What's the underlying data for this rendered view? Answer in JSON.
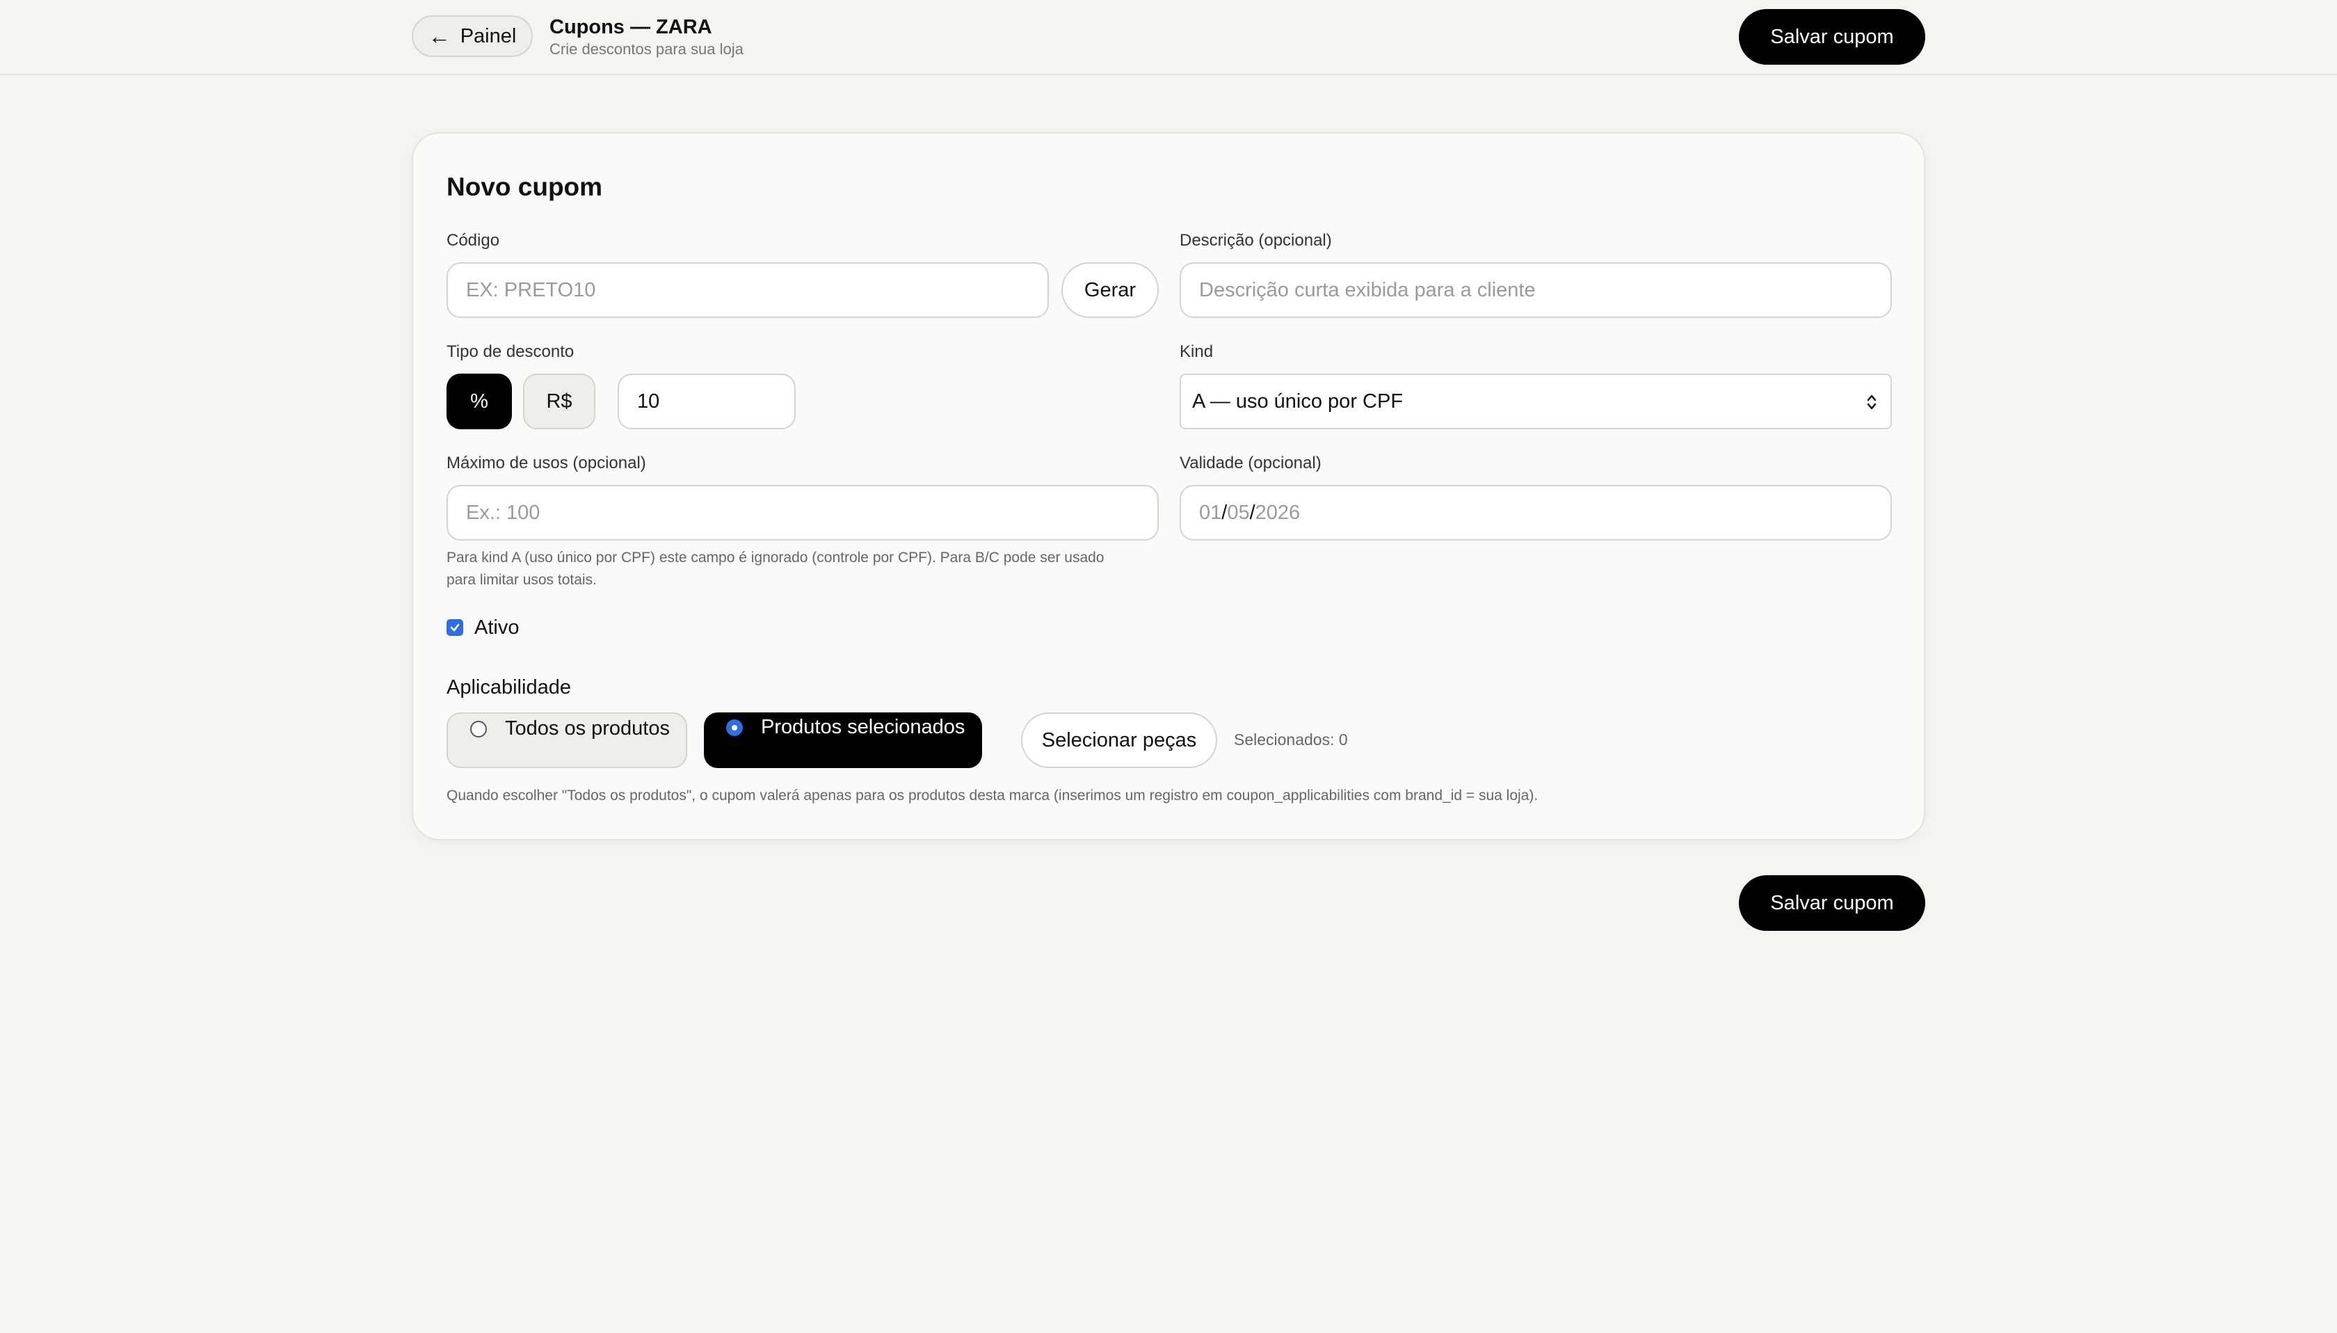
{
  "header": {
    "back_label": "Painel",
    "back_icon": "arrow-left-icon",
    "title": "Cupons — ZARA",
    "subtitle": "Crie descontos para sua loja",
    "save_label": "Salvar cupom"
  },
  "form": {
    "card_title": "Novo cupom",
    "code": {
      "label": "Código",
      "placeholder": "EX: PRETO10",
      "generate_label": "Gerar"
    },
    "description": {
      "label": "Descrição (opcional)",
      "placeholder": "Descrição curta exibida para a cliente"
    },
    "discount_type": {
      "label": "Tipo de desconto",
      "options": [
        "%",
        "R$"
      ],
      "selected": "%",
      "value": "10"
    },
    "kind": {
      "label": "Kind",
      "selected": "A — uso único por CPF"
    },
    "max_uses": {
      "label": "Máximo de usos (opcional)",
      "placeholder": "Ex.: 100",
      "help_line1": "Para kind A (uso único por CPF) este campo é ignorado (controle por CPF). Para B/C pode ser usado",
      "help_line2": "para limitar usos totais."
    },
    "validity": {
      "label": "Validade (opcional)",
      "day": "01",
      "month": "05",
      "year": "2026",
      "sep": "/"
    },
    "active": {
      "label": "Ativo",
      "checked": true
    },
    "applicability": {
      "heading": "Aplicabilidade",
      "options": [
        "Todos os produtos",
        "Produtos selecionados"
      ],
      "selected": "Produtos selecionados",
      "select_pieces_label": "Selecionar peças",
      "selected_count": "Selecionados: 0",
      "help": "Quando escolher \"Todos os produtos\", o cupom valerá apenas para os produtos desta marca (inserimos um registro em coupon_applicabilities com brand_id = sua loja)."
    }
  },
  "footer": {
    "save_label": "Salvar cupom"
  },
  "colors": {
    "background": "#f5f4f1",
    "accent": "#2f6fe0",
    "primary_button": "#000000"
  }
}
